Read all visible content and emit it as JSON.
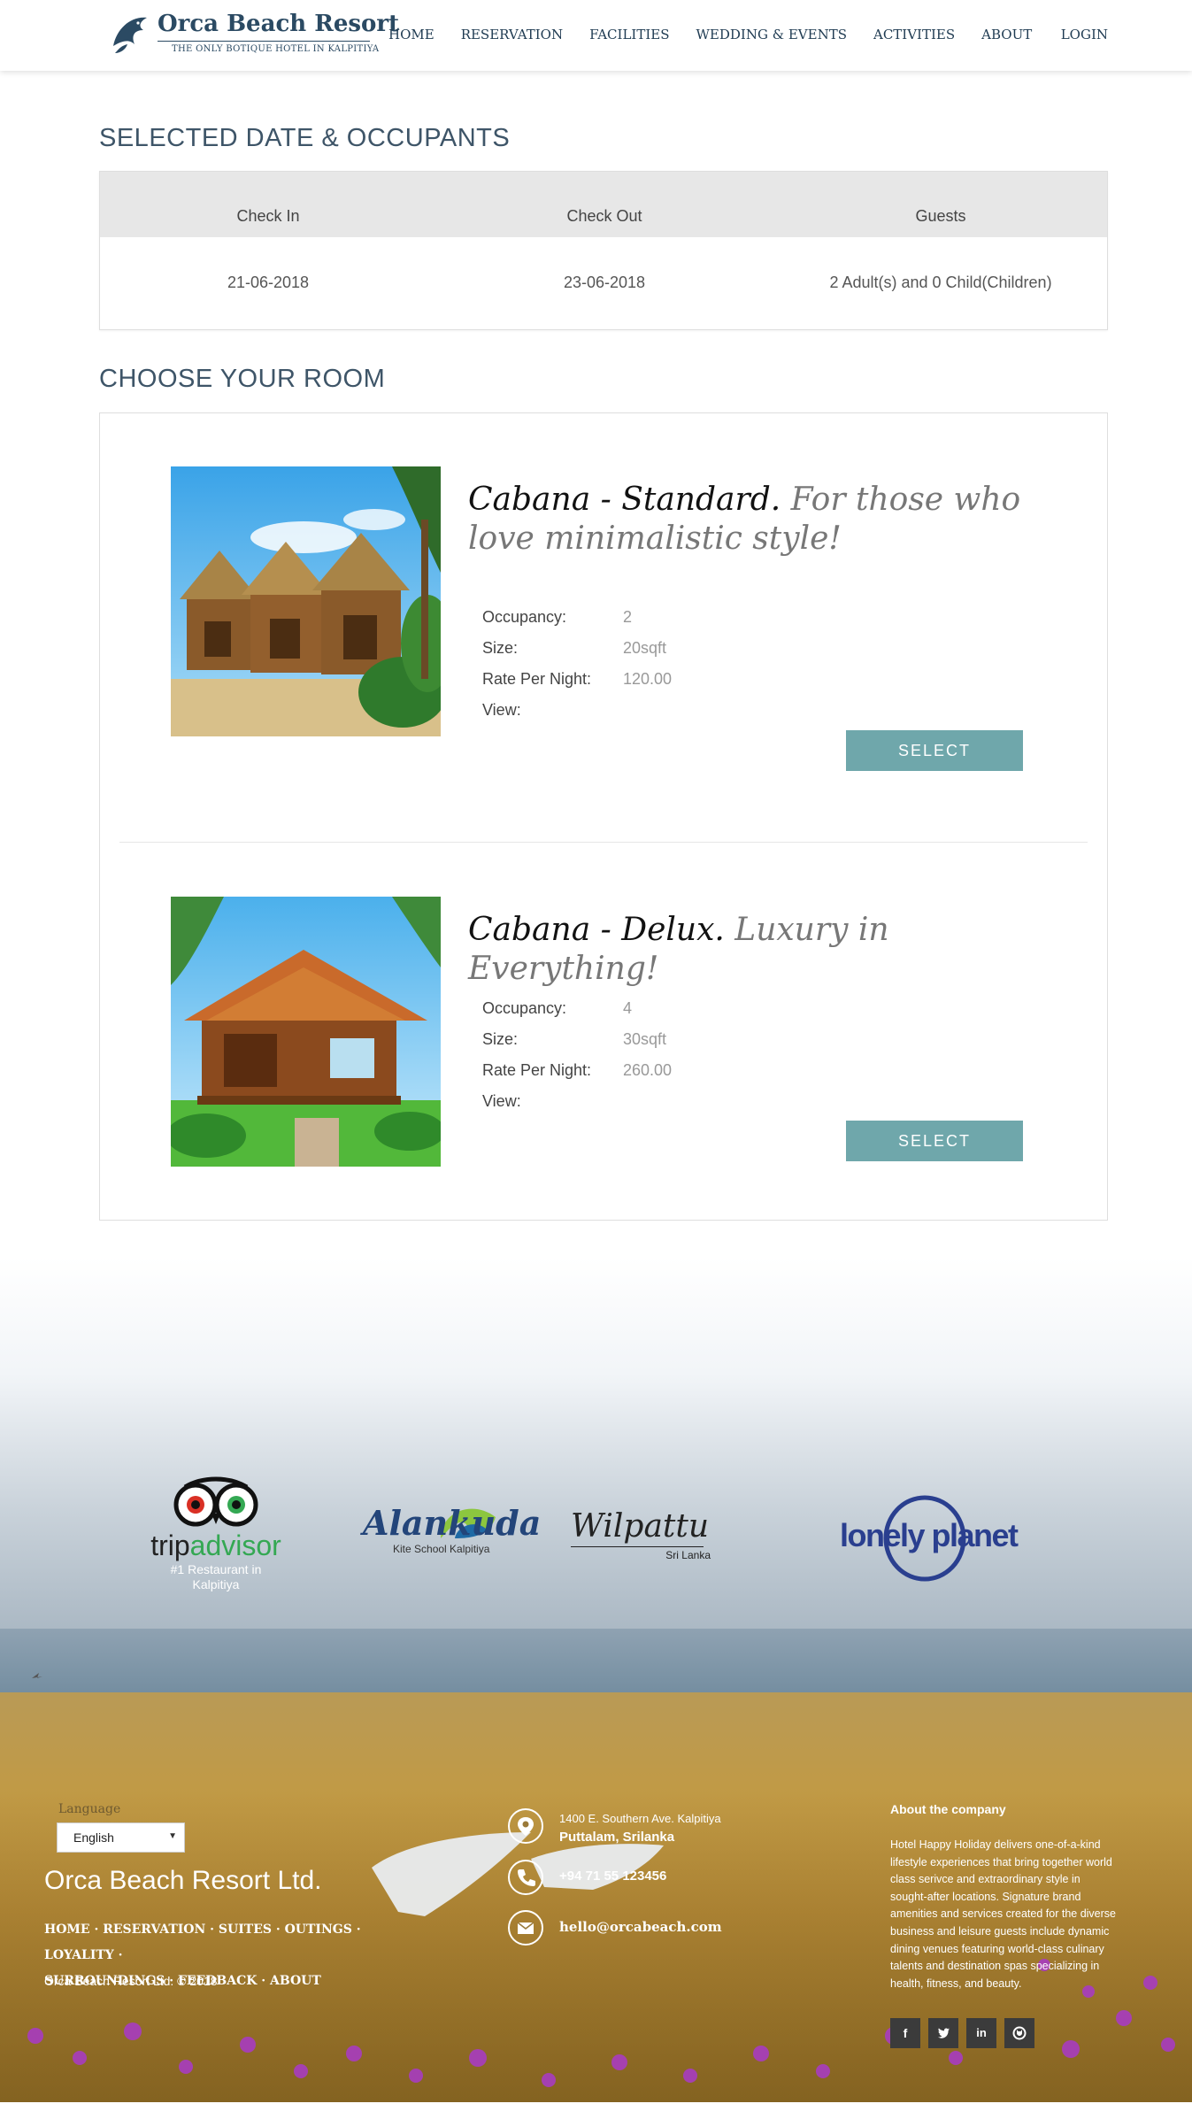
{
  "header": {
    "logo_name": "Orca Beach Resort",
    "logo_tagline": "THE ONLY BOTIQUE HOTEL IN KALPITIYA",
    "nav": [
      "HOME",
      "RESERVATION",
      "FACILITIES",
      "WEDDING & EVENTS",
      "ACTIVITIES",
      "ABOUT"
    ],
    "login": "LOGIN"
  },
  "occupants": {
    "title": "SELECTED DATE & OCCUPANTS",
    "headers": [
      "Check In",
      "Check Out",
      "Guests"
    ],
    "values": [
      "21-06-2018",
      "23-06-2018",
      "2 Adult(s) and 0 Child(Children)"
    ]
  },
  "rooms": {
    "title": "CHOOSE YOUR ROOM",
    "spec_labels": [
      "Occupancy:",
      "Size:",
      "Rate Per Night:",
      "View:"
    ],
    "items": [
      {
        "name": "Cabana - Standard.",
        "tagline": "For those who love minimalistic style!",
        "occupancy": "2",
        "size": "20sqft",
        "rate": "120.00",
        "view": "",
        "select_label": "SELECT"
      },
      {
        "name": "Cabana - Delux.",
        "tagline": "Luxury in Everything!",
        "occupancy": "4",
        "size": "30sqft",
        "rate": "260.00",
        "view": "",
        "select_label": "SELECT"
      }
    ]
  },
  "partners": {
    "tripadvisor_trip": "trip",
    "tripadvisor_advisor": "advisor",
    "tripadvisor_sub": "#1 Restaurant in Kalpitiya",
    "alankuda": "Alankuda",
    "alankuda_sub": "Kite School Kalpitiya",
    "wilpattu": "Wilpattu",
    "wilpattu_sub": "Sri Lanka",
    "lonely_planet": "lonely planet"
  },
  "footer": {
    "language_label": "Language",
    "language_value": "English",
    "company": "Orca Beach Resort Ltd.",
    "links": [
      "HOME",
      "RESERVATION",
      "SUITES",
      "OUTINGS",
      "LOYALITY",
      "SURROUNDINGS",
      "FEEDBACK",
      "ABOUT"
    ],
    "copyright": "Orca Beach Resort Ltd. © 2018",
    "address_line1": "1400 E. Southern Ave. Kalpitiya",
    "address_line2": "Puttalam, Srilanka",
    "phone": "+94 71 55 123456",
    "email": "hello@orcabeach.com",
    "about_title": "About the company",
    "about_text": "Hotel Happy Holiday delivers one-of-a-kind lifestyle experiences that bring together world class serivce and extraordinary style in sought-after locations. Signature brand amenities and services created for the diverse business and leisure guests include dynamic dining venues featuring world-class culinary talents and destination spas specializing in health, fitness, and beauty.",
    "social": [
      "f",
      "t",
      "in",
      "gh"
    ]
  },
  "colors": {
    "accent": "#6fa7ab",
    "navy": "#2b4a63",
    "title": "#3e5568"
  }
}
